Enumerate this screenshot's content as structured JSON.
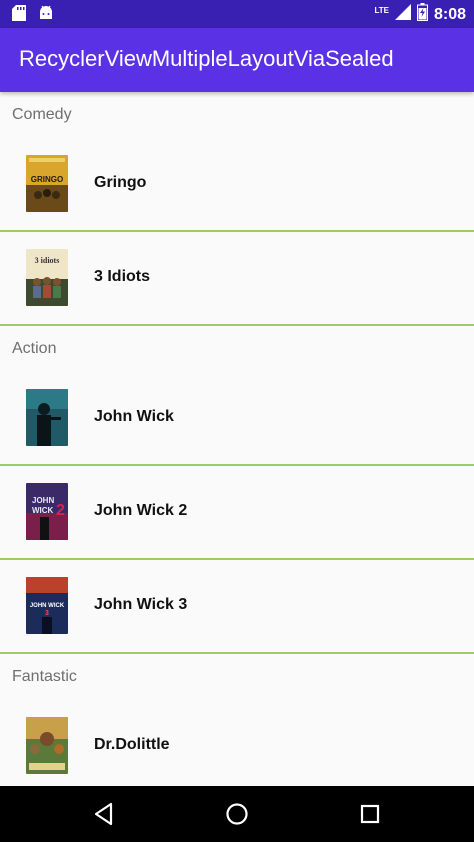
{
  "status_bar": {
    "time": "8:08",
    "network": "LTE",
    "battery_level": 0.85,
    "left_icons": [
      "sd-card-icon",
      "android-icon"
    ]
  },
  "app_bar": {
    "title": "RecyclerViewMultipleLayoutViaSealed",
    "color": "#5b31e6"
  },
  "list": {
    "divider_color": "#9ccc65",
    "sections": [
      {
        "header": "Comedy",
        "movies": [
          {
            "title": "Gringo",
            "poster": "gringo-poster"
          },
          {
            "title": "3 Idiots",
            "poster": "3-idiots-poster"
          }
        ]
      },
      {
        "header": "Action",
        "movies": [
          {
            "title": "John Wick",
            "poster": "john-wick-poster"
          },
          {
            "title": "John Wick 2",
            "poster": "john-wick-2-poster"
          },
          {
            "title": "John Wick 3",
            "poster": "john-wick-3-poster"
          }
        ]
      },
      {
        "header": "Fantastic",
        "movies": [
          {
            "title": "Dr.Dolittle",
            "poster": "dr-dolittle-poster"
          }
        ]
      }
    ]
  },
  "nav_bar": {
    "buttons": [
      "back-icon",
      "home-icon",
      "recents-icon"
    ]
  }
}
